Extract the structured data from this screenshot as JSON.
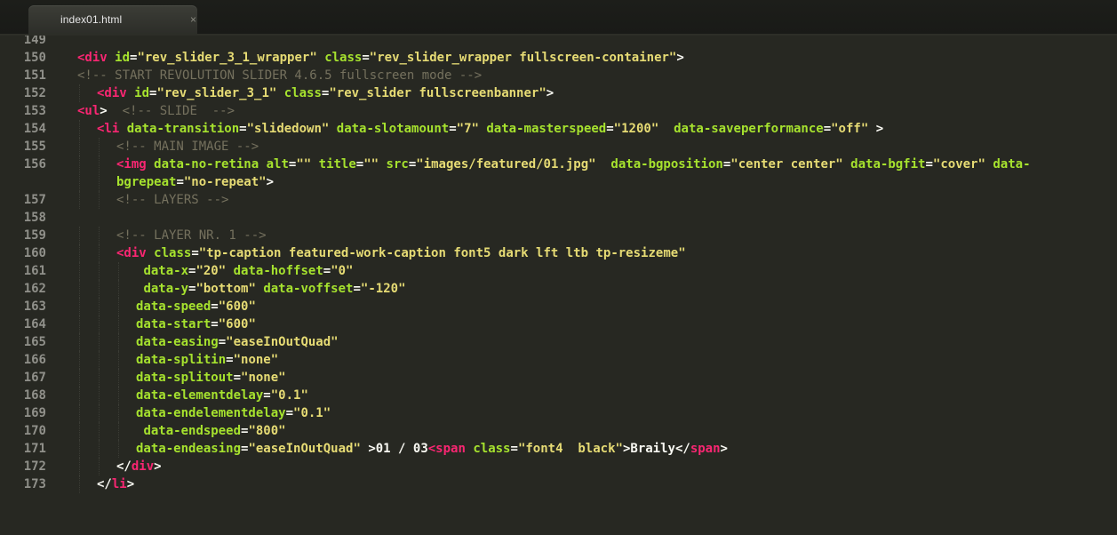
{
  "tab": {
    "title": "index01.html",
    "close_glyph": "×"
  },
  "editor": {
    "theme": {
      "background": "#272822",
      "tag": "#f92672",
      "attr": "#a6e22e",
      "string": "#e6db74",
      "comment": "#75715e",
      "text": "#f8f8f2",
      "gutter": "#90908a"
    },
    "lines": [
      {
        "num": "149",
        "indent": 0,
        "tokens": []
      },
      {
        "num": "150",
        "indent": 0,
        "tokens": [
          {
            "t": "tag",
            "v": "<div"
          },
          {
            "t": "text",
            "v": " "
          },
          {
            "t": "attr",
            "v": "id"
          },
          {
            "t": "punc",
            "v": "="
          },
          {
            "t": "str",
            "v": "\"rev_slider_3_1_wrapper\""
          },
          {
            "t": "text",
            "v": " "
          },
          {
            "t": "attr",
            "v": "class"
          },
          {
            "t": "punc",
            "v": "="
          },
          {
            "t": "str",
            "v": "\"rev_slider_wrapper fullscreen-container\""
          },
          {
            "t": "punc",
            "v": ">"
          }
        ]
      },
      {
        "num": "151",
        "indent": 0,
        "tokens": [
          {
            "t": "comment",
            "v": "<!-- START REVOLUTION SLIDER 4.6.5 fullscreen mode -->"
          }
        ]
      },
      {
        "num": "152",
        "indent": 1,
        "tokens": [
          {
            "t": "tag",
            "v": "<div"
          },
          {
            "t": "text",
            "v": " "
          },
          {
            "t": "attr",
            "v": "id"
          },
          {
            "t": "punc",
            "v": "="
          },
          {
            "t": "str",
            "v": "\"rev_slider_3_1\""
          },
          {
            "t": "text",
            "v": " "
          },
          {
            "t": "attr",
            "v": "class"
          },
          {
            "t": "punc",
            "v": "="
          },
          {
            "t": "str",
            "v": "\"rev_slider fullscreenbanner\""
          },
          {
            "t": "punc",
            "v": ">"
          }
        ]
      },
      {
        "num": "153",
        "indent": 0,
        "tokens": [
          {
            "t": "tag",
            "v": "<ul"
          },
          {
            "t": "punc",
            "v": ">"
          },
          {
            "t": "text",
            "v": "  "
          },
          {
            "t": "comment",
            "v": "<!-- SLIDE  -->"
          }
        ]
      },
      {
        "num": "154",
        "indent": 1,
        "tokens": [
          {
            "t": "tag",
            "v": "<li"
          },
          {
            "t": "text",
            "v": " "
          },
          {
            "t": "attr",
            "v": "data-transition"
          },
          {
            "t": "punc",
            "v": "="
          },
          {
            "t": "str",
            "v": "\"slidedown\""
          },
          {
            "t": "text",
            "v": " "
          },
          {
            "t": "attr",
            "v": "data-slotamount"
          },
          {
            "t": "punc",
            "v": "="
          },
          {
            "t": "str",
            "v": "\"7\""
          },
          {
            "t": "text",
            "v": " "
          },
          {
            "t": "attr",
            "v": "data-masterspeed"
          },
          {
            "t": "punc",
            "v": "="
          },
          {
            "t": "str",
            "v": "\"1200\""
          },
          {
            "t": "text",
            "v": "  "
          },
          {
            "t": "attr",
            "v": "data-saveperformance"
          },
          {
            "t": "punc",
            "v": "="
          },
          {
            "t": "str",
            "v": "\"off\""
          },
          {
            "t": "punc",
            "v": " >"
          }
        ]
      },
      {
        "num": "155",
        "indent": 2,
        "tokens": [
          {
            "t": "comment",
            "v": "<!-- MAIN IMAGE -->"
          }
        ]
      },
      {
        "num": "156",
        "indent": 2,
        "tall": true,
        "tokens": [
          {
            "t": "tag",
            "v": "<img"
          },
          {
            "t": "text",
            "v": " "
          },
          {
            "t": "attr",
            "v": "data-no-retina"
          },
          {
            "t": "text",
            "v": " "
          },
          {
            "t": "attr",
            "v": "alt"
          },
          {
            "t": "punc",
            "v": "="
          },
          {
            "t": "str",
            "v": "\"\""
          },
          {
            "t": "text",
            "v": " "
          },
          {
            "t": "attr",
            "v": "title"
          },
          {
            "t": "punc",
            "v": "="
          },
          {
            "t": "str",
            "v": "\"\""
          },
          {
            "t": "text",
            "v": " "
          },
          {
            "t": "attr",
            "v": "src"
          },
          {
            "t": "punc",
            "v": "="
          },
          {
            "t": "str",
            "v": "\"images/featured/01.jpg\""
          },
          {
            "t": "text",
            "v": "  "
          },
          {
            "t": "attr",
            "v": "data-bgposition"
          },
          {
            "t": "punc",
            "v": "="
          },
          {
            "t": "str",
            "v": "\"center center\""
          },
          {
            "t": "text",
            "v": " "
          },
          {
            "t": "attr",
            "v": "data-bgfit"
          },
          {
            "t": "punc",
            "v": "="
          },
          {
            "t": "str",
            "v": "\"cover\""
          },
          {
            "t": "text",
            "v": " "
          },
          {
            "t": "attr",
            "v": "data-bgrepeat"
          },
          {
            "t": "punc",
            "v": "="
          },
          {
            "t": "str",
            "v": "\"no-repeat\""
          },
          {
            "t": "punc",
            "v": ">"
          }
        ]
      },
      {
        "num": "157",
        "indent": 2,
        "tokens": [
          {
            "t": "comment",
            "v": "<!-- LAYERS -->"
          }
        ]
      },
      {
        "num": "158",
        "indent": 0,
        "tokens": []
      },
      {
        "num": "159",
        "indent": 2,
        "tokens": [
          {
            "t": "comment",
            "v": "<!-- LAYER NR. 1 -->"
          }
        ]
      },
      {
        "num": "160",
        "indent": 2,
        "tokens": [
          {
            "t": "tag",
            "v": "<div"
          },
          {
            "t": "text",
            "v": " "
          },
          {
            "t": "attr",
            "v": "class"
          },
          {
            "t": "punc",
            "v": "="
          },
          {
            "t": "str",
            "v": "\"tp-caption featured-work-caption font5 dark lft ltb tp-resizeme\""
          }
        ]
      },
      {
        "num": "161",
        "indent": 3,
        "tokens": [
          {
            "t": "text",
            "v": " "
          },
          {
            "t": "attr",
            "v": "data-x"
          },
          {
            "t": "punc",
            "v": "="
          },
          {
            "t": "str",
            "v": "\"20\""
          },
          {
            "t": "text",
            "v": " "
          },
          {
            "t": "attr",
            "v": "data-hoffset"
          },
          {
            "t": "punc",
            "v": "="
          },
          {
            "t": "str",
            "v": "\"0\""
          }
        ]
      },
      {
        "num": "162",
        "indent": 3,
        "tokens": [
          {
            "t": "text",
            "v": " "
          },
          {
            "t": "attr",
            "v": "data-y"
          },
          {
            "t": "punc",
            "v": "="
          },
          {
            "t": "str",
            "v": "\"bottom\""
          },
          {
            "t": "text",
            "v": " "
          },
          {
            "t": "attr",
            "v": "data-voffset"
          },
          {
            "t": "punc",
            "v": "="
          },
          {
            "t": "str",
            "v": "\"-120\""
          }
        ]
      },
      {
        "num": "163",
        "indent": 3,
        "tokens": [
          {
            "t": "attr",
            "v": "data-speed"
          },
          {
            "t": "punc",
            "v": "="
          },
          {
            "t": "str",
            "v": "\"600\""
          }
        ]
      },
      {
        "num": "164",
        "indent": 3,
        "tokens": [
          {
            "t": "attr",
            "v": "data-start"
          },
          {
            "t": "punc",
            "v": "="
          },
          {
            "t": "str",
            "v": "\"600\""
          }
        ]
      },
      {
        "num": "165",
        "indent": 3,
        "tokens": [
          {
            "t": "attr",
            "v": "data-easing"
          },
          {
            "t": "punc",
            "v": "="
          },
          {
            "t": "str",
            "v": "\"easeInOutQuad\""
          }
        ]
      },
      {
        "num": "166",
        "indent": 3,
        "tokens": [
          {
            "t": "attr",
            "v": "data-splitin"
          },
          {
            "t": "punc",
            "v": "="
          },
          {
            "t": "str",
            "v": "\"none\""
          }
        ]
      },
      {
        "num": "167",
        "indent": 3,
        "tokens": [
          {
            "t": "attr",
            "v": "data-splitout"
          },
          {
            "t": "punc",
            "v": "="
          },
          {
            "t": "str",
            "v": "\"none\""
          }
        ]
      },
      {
        "num": "168",
        "indent": 3,
        "tokens": [
          {
            "t": "attr",
            "v": "data-elementdelay"
          },
          {
            "t": "punc",
            "v": "="
          },
          {
            "t": "str",
            "v": "\"0.1\""
          }
        ]
      },
      {
        "num": "169",
        "indent": 3,
        "tokens": [
          {
            "t": "attr",
            "v": "data-endelementdelay"
          },
          {
            "t": "punc",
            "v": "="
          },
          {
            "t": "str",
            "v": "\"0.1\""
          }
        ]
      },
      {
        "num": "170",
        "indent": 3,
        "tokens": [
          {
            "t": "text",
            "v": " "
          },
          {
            "t": "attr",
            "v": "data-endspeed"
          },
          {
            "t": "punc",
            "v": "="
          },
          {
            "t": "str",
            "v": "\"800\""
          }
        ]
      },
      {
        "num": "171",
        "indent": 3,
        "tokens": [
          {
            "t": "attr",
            "v": "data-endeasing"
          },
          {
            "t": "punc",
            "v": "="
          },
          {
            "t": "str",
            "v": "\"easeInOutQuad\""
          },
          {
            "t": "text",
            "v": " >01 / 03"
          },
          {
            "t": "tag",
            "v": "<span"
          },
          {
            "t": "text",
            "v": " "
          },
          {
            "t": "attr",
            "v": "class"
          },
          {
            "t": "punc",
            "v": "="
          },
          {
            "t": "str",
            "v": "\"font4  black\""
          },
          {
            "t": "punc",
            "v": ">"
          },
          {
            "t": "text",
            "v": "Braily"
          },
          {
            "t": "punc",
            "v": "</"
          },
          {
            "t": "tag",
            "v": "span"
          },
          {
            "t": "punc",
            "v": ">"
          }
        ]
      },
      {
        "num": "172",
        "indent": 2,
        "tokens": [
          {
            "t": "punc",
            "v": "</"
          },
          {
            "t": "tag",
            "v": "div"
          },
          {
            "t": "punc",
            "v": ">"
          }
        ]
      },
      {
        "num": "173",
        "indent": 1,
        "tokens": [
          {
            "t": "punc",
            "v": "</"
          },
          {
            "t": "tag",
            "v": "li"
          },
          {
            "t": "punc",
            "v": ">"
          }
        ]
      }
    ]
  }
}
